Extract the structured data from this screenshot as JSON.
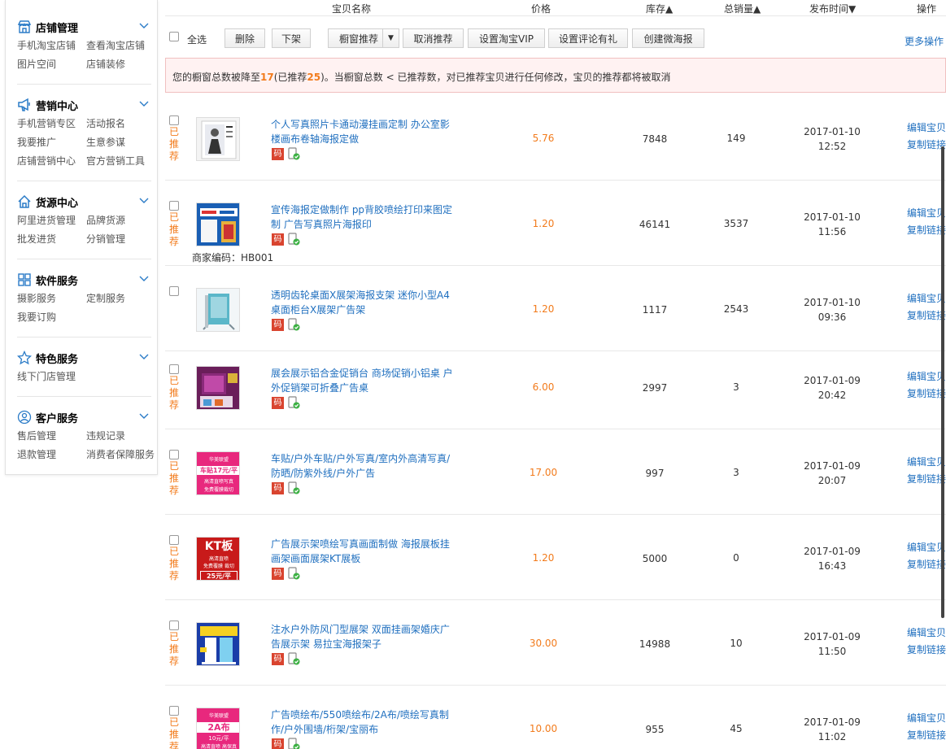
{
  "sidebar": {
    "sections": [
      {
        "title": "店铺管理",
        "icon": "store-icon",
        "links": [
          "手机淘宝店铺",
          "查看淘宝店铺",
          "图片空间",
          "店铺装修"
        ]
      },
      {
        "title": "营销中心",
        "icon": "megaphone-icon",
        "links": [
          "手机营销专区",
          "活动报名",
          "我要推广",
          "生意参谋",
          "店铺营销中心",
          "官方营销工具"
        ]
      },
      {
        "title": "货源中心",
        "icon": "house-icon",
        "links": [
          "阿里进货管理",
          "品牌货源",
          "批发进货",
          "分销管理"
        ]
      },
      {
        "title": "软件服务",
        "icon": "grid-icon",
        "links": [
          "摄影服务",
          "定制服务",
          "我要订购"
        ]
      },
      {
        "title": "特色服务",
        "icon": "star-icon",
        "links": [
          "线下门店管理"
        ]
      },
      {
        "title": "客户服务",
        "icon": "user-icon",
        "links": [
          "售后管理",
          "违规记录",
          "退款管理",
          "消费者保障服务"
        ]
      }
    ]
  },
  "header": {
    "name": "宝贝名称",
    "price": "价格",
    "stock": "库存",
    "sales": "总销量",
    "publish": "发布时间",
    "ops": "操作"
  },
  "toolbar": {
    "select_all": "全选",
    "delete": "删除",
    "delist": "下架",
    "window_recommend": "橱窗推荐",
    "cancel_recommend": "取消推荐",
    "set_vip": "设置淘宝VIP",
    "set_review": "设置评论有礼",
    "create_poster": "创建微海报",
    "more_ops": "更多操作"
  },
  "notice": {
    "prefix": "您的橱窗总数被降至",
    "total": "17",
    "mid1": "(已推荐",
    "recommended": "25",
    "suffix": ")。当橱窗总数 < 已推荐数，对已推荐宝贝进行任何修改，宝贝的推荐都将被取消"
  },
  "rows": [
    {
      "recommended": true,
      "rec_label": "已推荐",
      "title": "个人写真照片卡通动漫挂画定制 办公室影楼画布卷轴海报定做",
      "price": "5.76",
      "stock": "7848",
      "sales": "149",
      "date": "2017-01-10",
      "time": "12:52",
      "edit": "编辑宝贝",
      "copy": "复制链接",
      "code": ""
    },
    {
      "recommended": true,
      "rec_label": "已推荐",
      "title": "宣传海报定做制作 pp背胶喷绘打印来图定制 广告写真照片海报印",
      "price": "1.20",
      "stock": "46141",
      "sales": "3537",
      "date": "2017-01-10",
      "time": "11:56",
      "edit": "编辑宝贝",
      "copy": "复制链接",
      "code": "商家编码：HB001"
    },
    {
      "recommended": false,
      "rec_label": "",
      "title": "透明齿轮桌面X展架海报支架 迷你小型A4桌面柜台X展架广告架",
      "price": "1.20",
      "stock": "1117",
      "sales": "2543",
      "date": "2017-01-10",
      "time": "09:36",
      "edit": "编辑宝贝",
      "copy": "复制链接",
      "code": ""
    },
    {
      "recommended": true,
      "rec_label": "已推荐",
      "title": "展会展示铝合金促销台 商场促销小铝桌 户外促销架可折叠广告桌",
      "price": "6.00",
      "stock": "2997",
      "sales": "3",
      "date": "2017-01-09",
      "time": "20:42",
      "edit": "编辑宝贝",
      "copy": "复制链接",
      "code": ""
    },
    {
      "recommended": true,
      "rec_label": "已推荐",
      "title": "车贴/户外车贴/户外写真/室内外高清写真/防晒/防紫外线/户外广告",
      "price": "17.00",
      "stock": "997",
      "sales": "3",
      "date": "2017-01-09",
      "time": "20:07",
      "edit": "编辑宝贝",
      "copy": "复制链接",
      "code": ""
    },
    {
      "recommended": true,
      "rec_label": "已推荐",
      "title": "广告展示架喷绘写真画面制做 海报展板挂画架画面展架KT展板",
      "price": "1.20",
      "stock": "5000",
      "sales": "0",
      "date": "2017-01-09",
      "time": "16:43",
      "edit": "编辑宝贝",
      "copy": "复制链接",
      "code": ""
    },
    {
      "recommended": true,
      "rec_label": "已推荐",
      "title": "注水户外防风门型展架 双面挂画架婚庆广告展示架 易拉宝海报架子",
      "price": "30.00",
      "stock": "14988",
      "sales": "10",
      "date": "2017-01-09",
      "time": "11:50",
      "edit": "编辑宝贝",
      "copy": "复制链接",
      "code": ""
    },
    {
      "recommended": true,
      "rec_label": "已推荐",
      "title": "广告喷绘布/550喷绘布/2A布/喷绘写真制作/户外围墙/桁架/宝丽布",
      "price": "10.00",
      "stock": "955",
      "sales": "45",
      "date": "2017-01-09",
      "time": "11:02",
      "edit": "编辑宝贝",
      "copy": "复制链接",
      "code": ""
    }
  ],
  "thumb_text": {
    "t5_top": "华美联盟",
    "t5_mid": "车贴17元/平",
    "t5_sub": "高清直喷写真",
    "t5_sub2": "免费覆膜裁切",
    "t6_big": "KT板",
    "t6_sub": "高清直喷",
    "t6_sub2": "免费覆膜 裁切",
    "t6_price": "25元/平",
    "t8_top": "华美联盟",
    "t8_big": "2A布",
    "t8_price": "10元/平",
    "t8_sub": "高清直喷 高保真"
  },
  "badge_code": "码",
  "colors": {
    "orange": "#f27b1c",
    "link": "#1f6fbf",
    "notice_bg": "#fff2f2"
  }
}
